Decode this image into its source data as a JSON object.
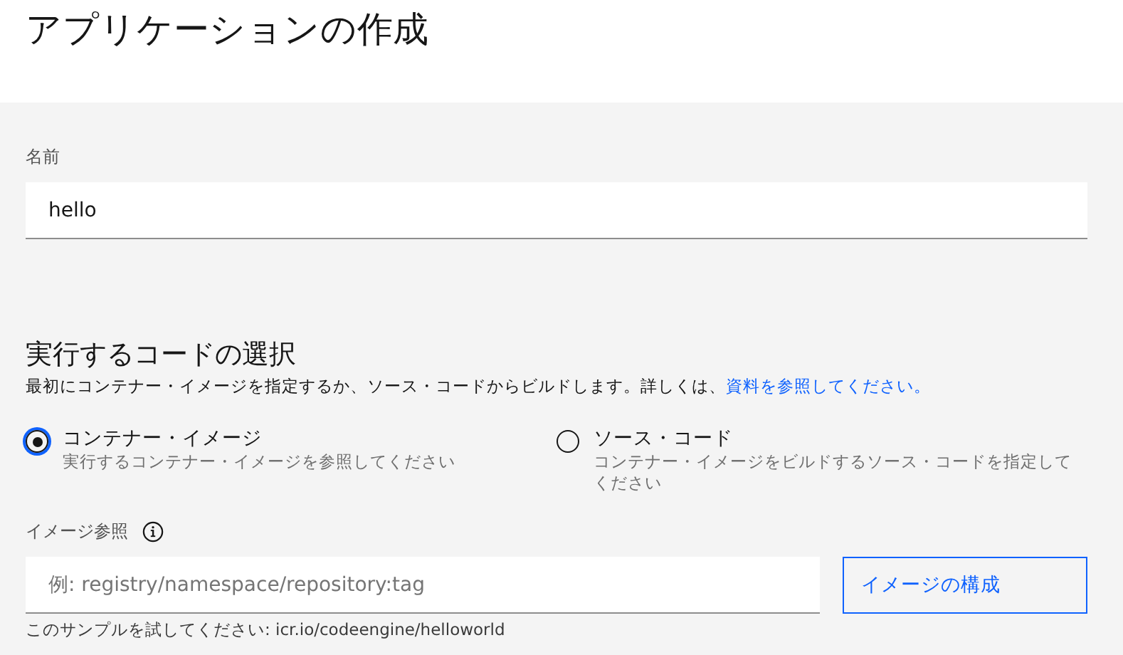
{
  "page_title": "アプリケーションの作成",
  "name_field": {
    "label": "名前",
    "value": "hello"
  },
  "code_section": {
    "heading": "実行するコードの選択",
    "description": "最初にコンテナー・イメージを指定するか、ソース・コードからビルドします。詳しくは、",
    "link": "資料を参照してください。",
    "options": [
      {
        "label": "コンテナー・イメージ",
        "hint": "実行するコンテナー・イメージを参照してください",
        "selected": true
      },
      {
        "label": "ソース・コード",
        "hint": "コンテナー・イメージをビルドするソース・コードを指定してください",
        "selected": false
      }
    ]
  },
  "image_field": {
    "label": "イメージ参照",
    "placeholder": "例: registry/namespace/repository:tag",
    "helper": "このサンプルを試してください: icr.io/codeengine/helloworld",
    "button": "イメージの構成"
  }
}
